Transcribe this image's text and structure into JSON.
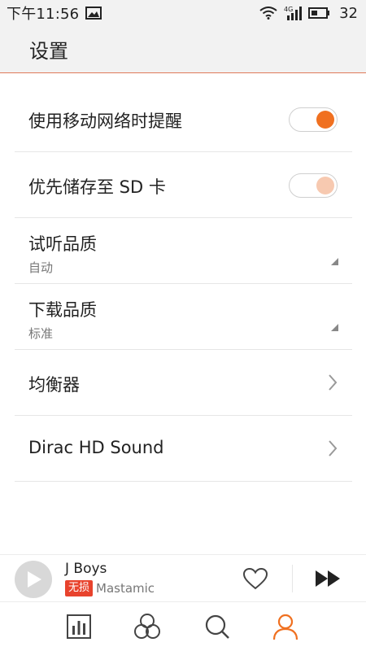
{
  "status_bar": {
    "time": "下午11:56",
    "network_type": "4G",
    "battery": "32"
  },
  "header": {
    "title": "设置"
  },
  "settings": {
    "mobile_network_alert": {
      "label": "使用移动网络时提醒",
      "enabled": true
    },
    "prefer_sd_card": {
      "label": "优先储存至 SD 卡",
      "enabled": true
    },
    "preview_quality": {
      "label": "试听品质",
      "value": "自动"
    },
    "download_quality": {
      "label": "下载品质",
      "value": "标准"
    },
    "equalizer": {
      "label": "均衡器"
    },
    "dirac": {
      "label": "Dirac HD Sound"
    }
  },
  "player": {
    "track_title": "J Boys",
    "badge": "无损",
    "artist": "Mastamic"
  },
  "colors": {
    "accent": "#f07020",
    "badge": "#e8432d"
  },
  "icons": {
    "status": [
      "gallery-icon",
      "wifi-icon",
      "signal-icon",
      "battery-icon"
    ],
    "player": [
      "play-icon",
      "heart-icon",
      "next-icon"
    ],
    "nav": [
      "chart-icon",
      "discover-icon",
      "search-icon",
      "profile-icon"
    ]
  }
}
